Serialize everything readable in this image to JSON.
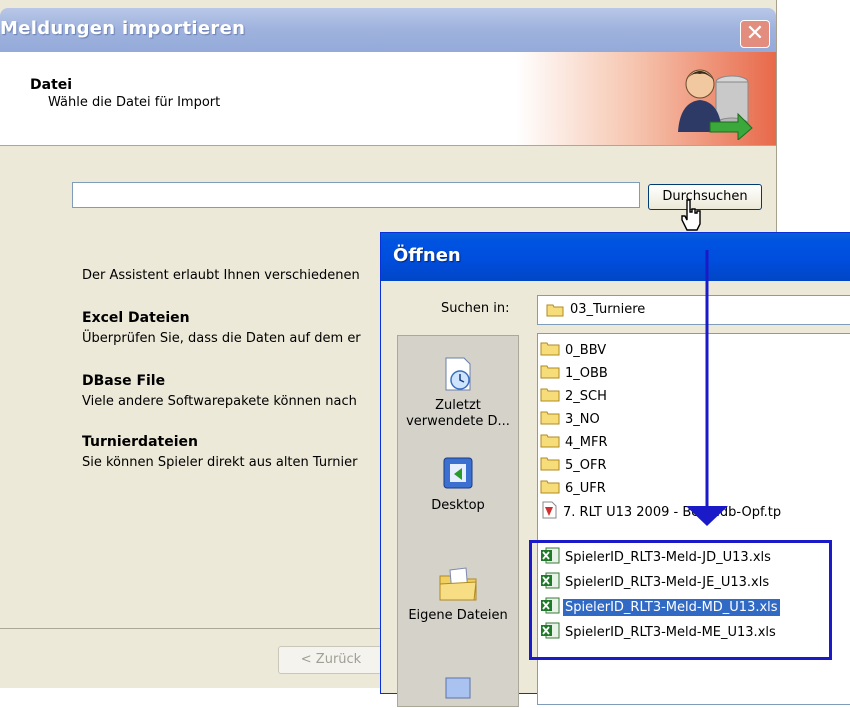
{
  "wizard": {
    "title": "Meldungen importieren",
    "close_label": "X",
    "header_title": "Datei",
    "header_subtitle": "Wähle die Datei für Import",
    "file_input_value": "",
    "browse_label": "Durchsuchen",
    "intro_text": "Der Assistent erlaubt Ihnen verschiedenen",
    "sections": [
      {
        "title": "Excel Dateien",
        "text": "Überprüfen Sie, dass die Daten auf dem er"
      },
      {
        "title": "DBase File",
        "text": "Viele andere Softwarepakete können nach"
      },
      {
        "title": "Turnierdateien",
        "text": "Sie können Spieler direkt aus alten Turnier"
      }
    ],
    "back_label": "< Zurück"
  },
  "open_dialog": {
    "title": "Öffnen",
    "look_in_label": "Suchen in:",
    "look_in_value": "03_Turniere",
    "places": [
      "Zuletzt verwendete D...",
      "Desktop",
      "Eigene Dateien"
    ],
    "folders": [
      "0_BBV",
      "1_OBB",
      "2_SCH",
      "3_NO",
      "4_MFR",
      "5_OFR",
      "6_UFR"
    ],
    "tournament_file": "7. RLT U13 2009 - Bez Ndb-Opf.tp",
    "excel_files": [
      "SpielerID_RLT3-Meld-JD_U13.xls",
      "SpielerID_RLT3-Meld-JE_U13.xls",
      "SpielerID_RLT3-Meld-MD_U13.xls",
      "SpielerID_RLT3-Meld-ME_U13.xls"
    ],
    "selected_file": "SpielerID_RLT3-Meld-MD_U13.xls"
  },
  "colors": {
    "annotation": "#1a1ac8",
    "selection": "#316ac5",
    "xp_blue": "#0053e1"
  }
}
